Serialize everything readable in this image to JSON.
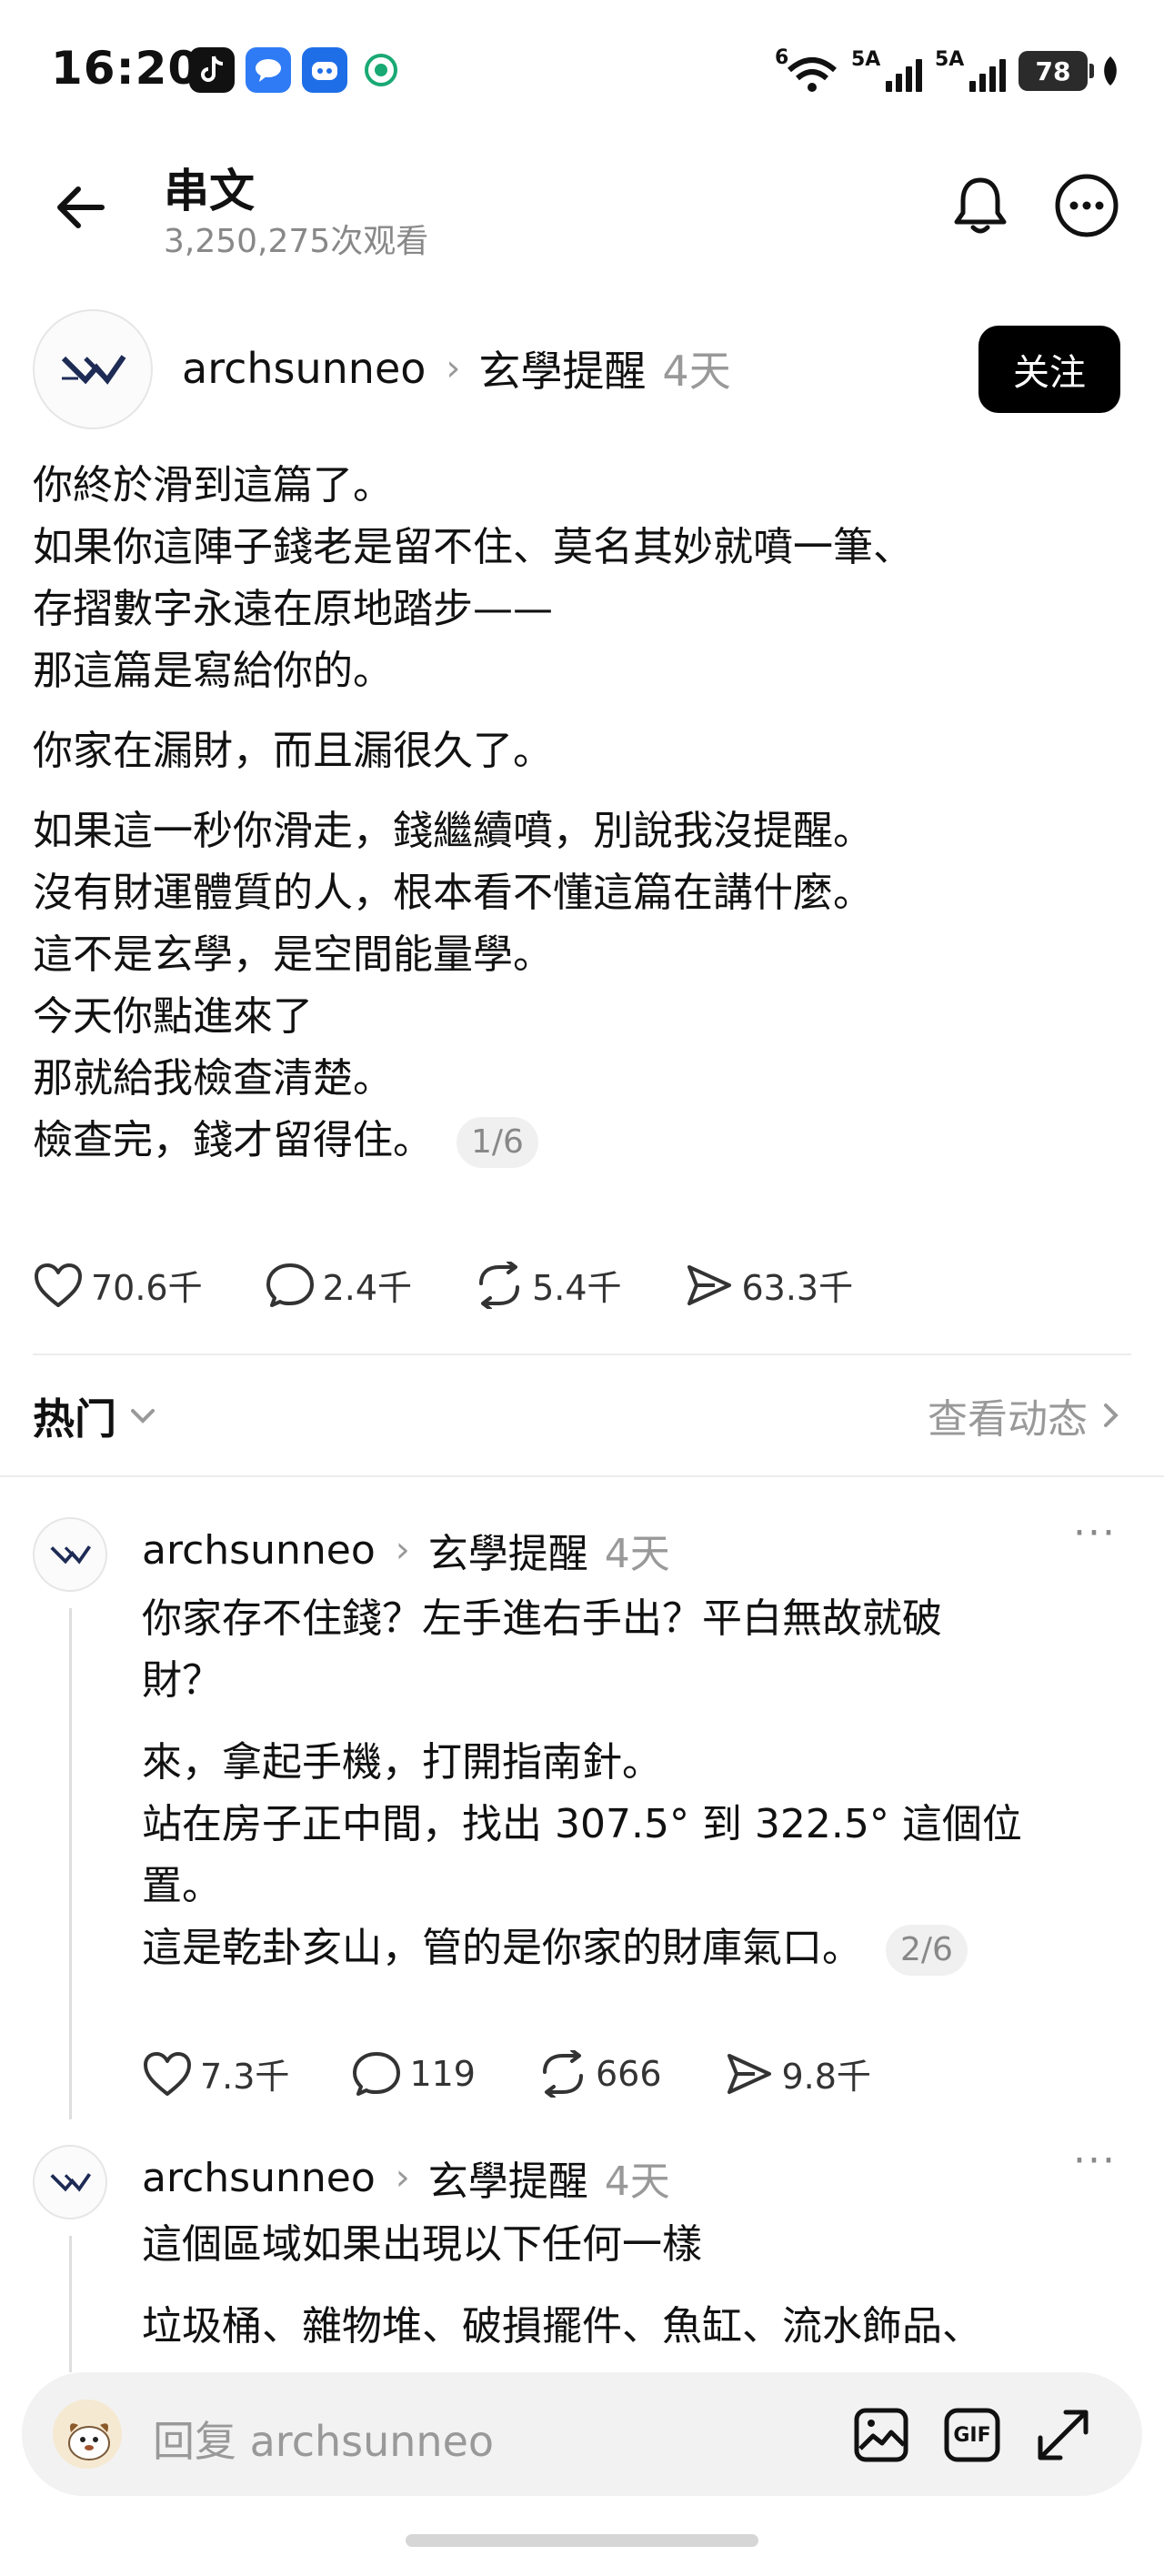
{
  "status_bar": {
    "time": "16:20",
    "sig1_label": "5A",
    "sig2_label": "5A",
    "wifi_label": "6",
    "battery": "78"
  },
  "header": {
    "title": "串文",
    "views": "3,250,275次观看"
  },
  "post": {
    "username": "archsunneo",
    "topic": "玄學提醒",
    "ago": "4天",
    "follow_label": "关注",
    "paragraphs": [
      [
        "你終於滑到這篇了。",
        "如果你這陣子錢老是留不住、莫名其妙就噴一筆、",
        "存摺數字永遠在原地踏步——",
        "那這篇是寫給你的。"
      ],
      [
        "你家在漏財，而且漏很久了。"
      ],
      [
        "如果這一秒你滑走，錢繼續噴，別說我沒提醒。",
        "沒有財運體質的人，根本看不懂這篇在講什麼。",
        "這不是玄學，是空間能量學。",
        "今天你點進來了",
        "那就給我檢查清楚。",
        "檢查完，錢才留得住。"
      ]
    ],
    "pager": "1/6",
    "likes": "70.6千",
    "comments": "2.4千",
    "reposts": "5.4千",
    "shares": "63.3千"
  },
  "sort": {
    "label": "热门",
    "see_activity": "查看动态"
  },
  "replies": [
    {
      "username": "archsunneo",
      "topic": "玄學提醒",
      "ago": "4天",
      "more": "···",
      "paragraphs": [
        [
          "你家存不住錢？左手進右手出？平白無故就破",
          "財？"
        ],
        [
          "來，拿起手機，打開指南針。",
          "站在房子正中間，找出 307.5° 到 322.5° 這個位",
          "置。",
          "這是乾卦亥山，管的是你家的財庫氣口。"
        ]
      ],
      "pager": "2/6",
      "likes": "7.3千",
      "comments": "119",
      "reposts": "666",
      "shares": "9.8千"
    },
    {
      "username": "archsunneo",
      "topic": "玄學提醒",
      "ago": "4天",
      "more": "···",
      "paragraphs": [
        [
          "這個區域如果出現以下任何一樣"
        ],
        [
          "垃圾桶、雜物堆、破損擺件、魚缸、流水飾品、"
        ]
      ]
    }
  ],
  "composer": {
    "placeholder": "回复 archsunneo",
    "gif_label": "GIF"
  },
  "icons": [
    "back-arrow-icon",
    "bell-icon",
    "more-icon",
    "heart-icon",
    "comment-icon",
    "repost-icon",
    "share-icon",
    "chevron-down-icon",
    "chevron-right-icon",
    "image-icon",
    "gif-icon",
    "expand-icon"
  ]
}
